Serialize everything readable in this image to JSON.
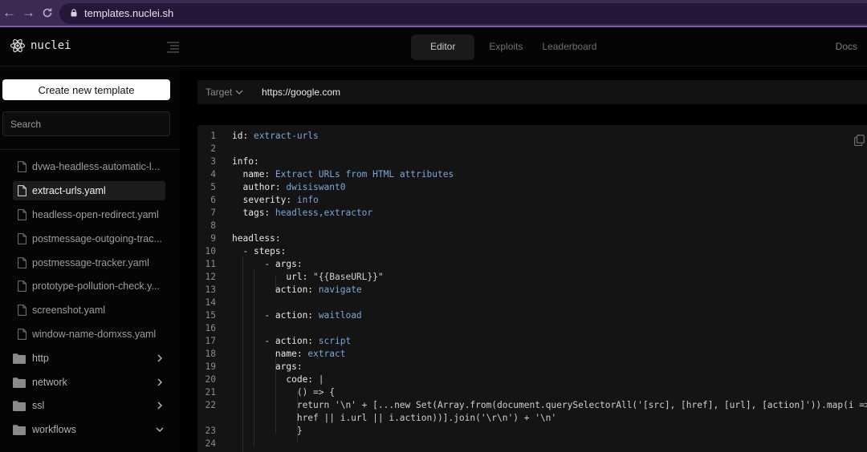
{
  "browser": {
    "url": "templates.nuclei.sh"
  },
  "app": {
    "logo_text": "nuclei",
    "nav_tabs": [
      "Editor",
      "Exploits",
      "Leaderboard"
    ],
    "active_tab": "Editor",
    "docs_label": "Docs"
  },
  "sidebar": {
    "create_label": "Create new template",
    "search_placeholder": "Search",
    "files": [
      {
        "label": "dvwa-headless-automatic-l...",
        "selected": false
      },
      {
        "label": "extract-urls.yaml",
        "selected": true
      },
      {
        "label": "headless-open-redirect.yaml",
        "selected": false
      },
      {
        "label": "postmessage-outgoing-trac...",
        "selected": false
      },
      {
        "label": "postmessage-tracker.yaml",
        "selected": false
      },
      {
        "label": "prototype-pollution-check.y...",
        "selected": false
      },
      {
        "label": "screenshot.yaml",
        "selected": false
      },
      {
        "label": "window-name-domxss.yaml",
        "selected": false
      }
    ],
    "folders": [
      {
        "label": "http",
        "expanded": false
      },
      {
        "label": "network",
        "expanded": false
      },
      {
        "label": "ssl",
        "expanded": false
      },
      {
        "label": "workflows",
        "expanded": true
      }
    ]
  },
  "target": {
    "label": "Target",
    "url": "https://google.com"
  },
  "editor": {
    "lines": [
      {
        "n": "1",
        "key": "id",
        "val": "extract-urls"
      },
      {
        "n": "2"
      },
      {
        "n": "3",
        "key": "info",
        "val": ""
      },
      {
        "n": "4",
        "indent": "  ",
        "key": "name",
        "val": "Extract URLs from HTML attributes"
      },
      {
        "n": "5",
        "indent": "  ",
        "key": "author",
        "val": "dwisiswant0"
      },
      {
        "n": "6",
        "indent": "  ",
        "key": "severity",
        "val": "info"
      },
      {
        "n": "7",
        "indent": "  ",
        "key": "tags",
        "val": "headless,extractor"
      },
      {
        "n": "8"
      },
      {
        "n": "9",
        "key": "headless",
        "val": ""
      },
      {
        "n": "10",
        "indent": "  - ",
        "key": "steps",
        "val": ""
      },
      {
        "n": "11",
        "indent": "      - ",
        "key": "args",
        "val": ""
      },
      {
        "n": "12",
        "indent": "          ",
        "key": "url",
        "str": "\"{{BaseURL}}\""
      },
      {
        "n": "13",
        "indent": "        ",
        "key": "action",
        "val": "navigate"
      },
      {
        "n": "14"
      },
      {
        "n": "15",
        "indent": "      - ",
        "key": "action",
        "val": "waitload"
      },
      {
        "n": "16"
      },
      {
        "n": "17",
        "indent": "      - ",
        "key": "action",
        "val": "script"
      },
      {
        "n": "18",
        "indent": "        ",
        "key": "name",
        "val": "extract"
      },
      {
        "n": "19",
        "indent": "        ",
        "key": "args",
        "val": ""
      },
      {
        "n": "20",
        "indent": "          ",
        "key": "code",
        "str": "|"
      },
      {
        "n": "21",
        "indent": "            ",
        "text": "() => {"
      },
      {
        "n": "22",
        "indent": "            ",
        "text": "return '\\n' + [...new Set(Array.from(document.querySelectorAll('[src], [href], [url], [action]')).map(i => i.src || i."
      },
      {
        "n": "",
        "indent": "            ",
        "text": "href || i.url || i.action))].join('\\r\\n') + '\\n'"
      },
      {
        "n": "23",
        "indent": "            ",
        "text": "}"
      },
      {
        "n": "24"
      }
    ]
  }
}
